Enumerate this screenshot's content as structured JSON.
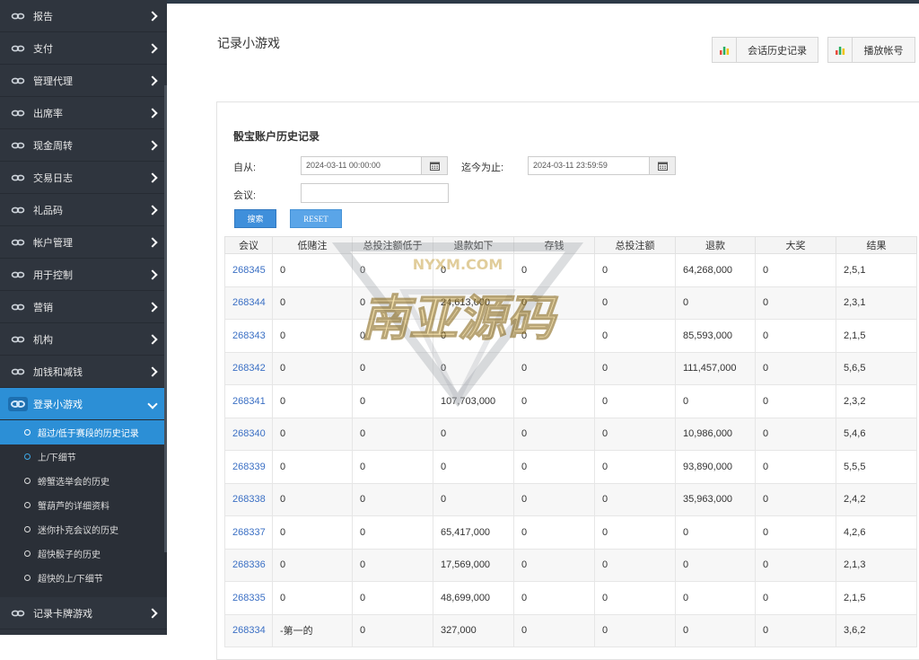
{
  "sidebar": {
    "items_top": [
      {
        "label": "报告"
      },
      {
        "label": "支付"
      },
      {
        "label": "管理代理"
      },
      {
        "label": "出席率"
      },
      {
        "label": "现金周转"
      },
      {
        "label": "交易日志"
      },
      {
        "label": "礼品码"
      },
      {
        "label": "帐户管理"
      },
      {
        "label": "用于控制"
      },
      {
        "label": "营销"
      },
      {
        "label": "机构"
      },
      {
        "label": "加钱和减钱"
      }
    ],
    "active_item": {
      "label": "登录小游戏"
    },
    "sub_items": [
      {
        "label": "超过/低于赛段的历史记录"
      },
      {
        "label": "上/下细节"
      },
      {
        "label": "螃蟹选举会的历史"
      },
      {
        "label": "蟹葫芦的详细资料"
      },
      {
        "label": "迷你扑克会议的历史"
      },
      {
        "label": "超快骰子的历史"
      },
      {
        "label": "超快的上/下细节"
      }
    ],
    "items_bottom": [
      {
        "label": "记录卡牌游戏"
      }
    ]
  },
  "header": {
    "title": "记录小游戏",
    "btn_session_history": "会话历史记录",
    "btn_play_account": "播放帐号"
  },
  "panel": {
    "title": "骰宝账户历史记录",
    "from_label": "自从:",
    "from_value": "2024-03-11 00:00:00",
    "to_label": "迄今为止:",
    "to_value": "2024-03-11 23:59:59",
    "session_label": "会议:",
    "session_value": "",
    "search_button": "搜索",
    "reset_button": "RESET"
  },
  "table": {
    "columns": [
      "会议",
      "低赌注",
      "总投注额低于",
      "退款如下",
      "存钱",
      "总投注额",
      "退款",
      "大奖",
      "结果"
    ],
    "rows": [
      [
        "268345",
        "0",
        "0",
        "0",
        "0",
        "0",
        "64,268,000",
        "0",
        "2,5,1"
      ],
      [
        "268344",
        "0",
        "0",
        "24,613,000",
        "0",
        "0",
        "0",
        "0",
        "2,3,1"
      ],
      [
        "268343",
        "0",
        "0",
        "0",
        "0",
        "0",
        "85,593,000",
        "0",
        "2,1,5"
      ],
      [
        "268342",
        "0",
        "0",
        "0",
        "0",
        "0",
        "111,457,000",
        "0",
        "5,6,5"
      ],
      [
        "268341",
        "0",
        "0",
        "107,703,000",
        "0",
        "0",
        "0",
        "0",
        "2,3,2"
      ],
      [
        "268340",
        "0",
        "0",
        "0",
        "0",
        "0",
        "10,986,000",
        "0",
        "5,4,6"
      ],
      [
        "268339",
        "0",
        "0",
        "0",
        "0",
        "0",
        "93,890,000",
        "0",
        "5,5,5"
      ],
      [
        "268338",
        "0",
        "0",
        "0",
        "0",
        "0",
        "35,963,000",
        "0",
        "2,4,2"
      ],
      [
        "268337",
        "0",
        "0",
        "65,417,000",
        "0",
        "0",
        "0",
        "0",
        "4,2,6"
      ],
      [
        "268336",
        "0",
        "0",
        "17,569,000",
        "0",
        "0",
        "0",
        "0",
        "2,1,3"
      ],
      [
        "268335",
        "0",
        "0",
        "48,699,000",
        "0",
        "0",
        "0",
        "0",
        "2,1,5"
      ],
      [
        "268334",
        "-第一的",
        "0",
        "327,000",
        "0",
        "0",
        "0",
        "0",
        "3,6,2"
      ]
    ]
  },
  "watermark": {
    "text": "南亚源码",
    "subtext": "NYXM.COM"
  },
  "colors": {
    "sidebar_bg": "#2f353e",
    "accent": "#2c8fd6",
    "link": "#3a6fc4"
  }
}
